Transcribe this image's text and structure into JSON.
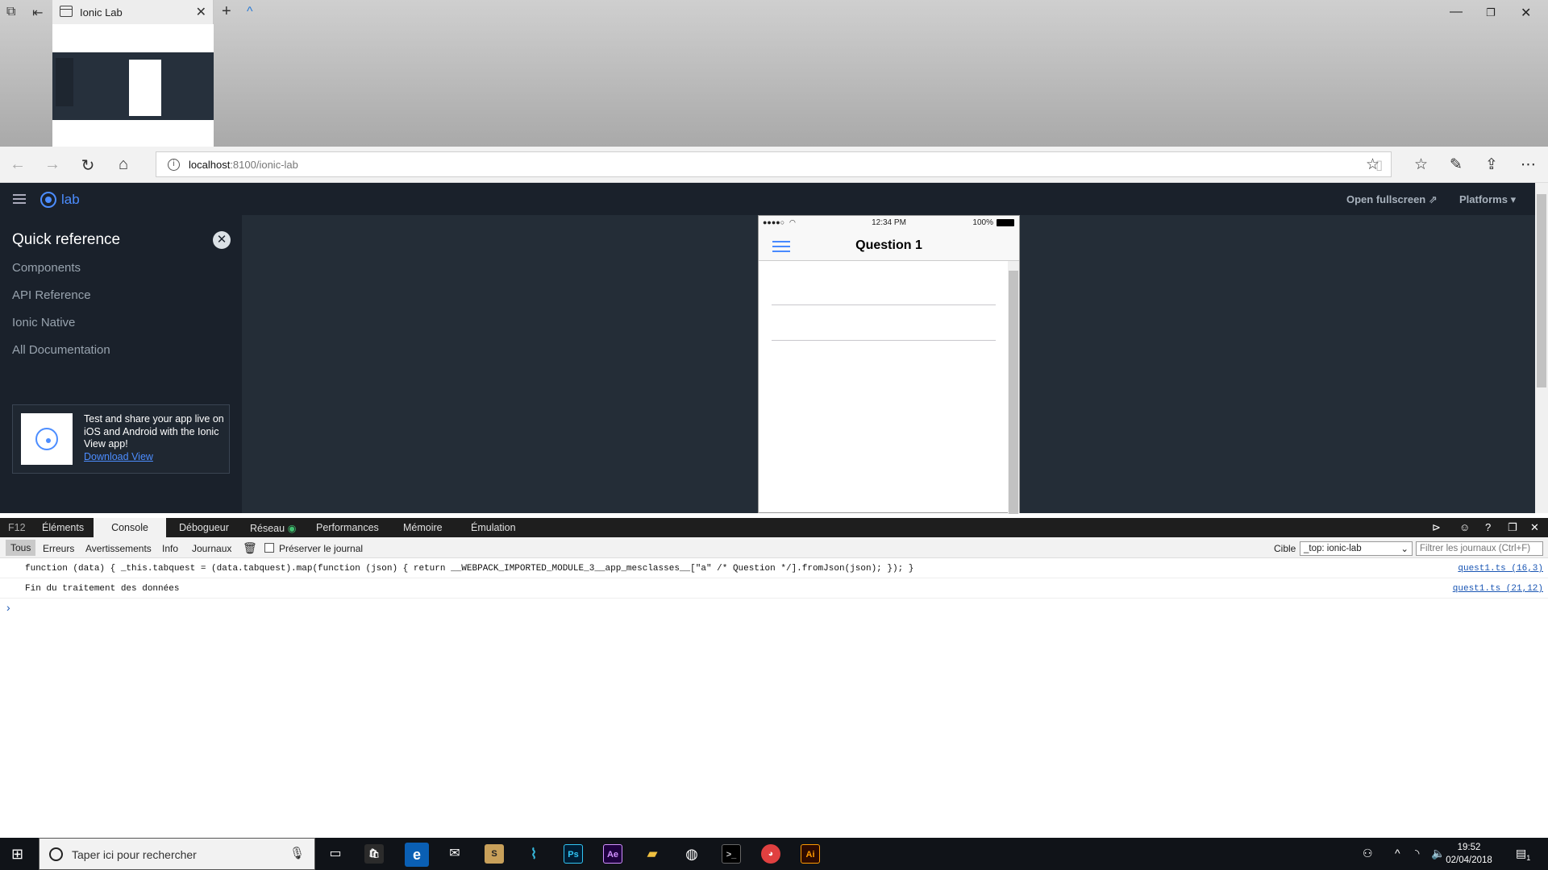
{
  "browser": {
    "tab_title": "Ionic Lab",
    "url_host": "localhost",
    "url_path": ":8100/ionic-lab"
  },
  "lab": {
    "logo_text": "lab",
    "open_fullscreen": "Open fullscreen",
    "platforms": "Platforms",
    "sidebar_title": "Quick reference",
    "sidebar_items": [
      "Components",
      "API Reference",
      "Ionic Native",
      "All Documentation"
    ],
    "promo_text": "Test and share your app live on iOS and Android with the Ionic View app!",
    "promo_link": "Download View"
  },
  "phone": {
    "signal": "●●●●○",
    "time": "12:34 PM",
    "battery": "100%",
    "title": "Question 1"
  },
  "devtools": {
    "f12": "F12",
    "tabs": [
      "Éléments",
      "Console",
      "Débogueur",
      "Réseau",
      "Performances",
      "Mémoire",
      "Émulation"
    ],
    "filters": [
      "Tous",
      "Erreurs",
      "Avertissements",
      "Info",
      "Journaux"
    ],
    "preserve_log": "Préserver le journal",
    "target_label": "Cible",
    "target_value": "_top: ionic-lab",
    "filter_placeholder": "Filtrer les journaux (Ctrl+F)",
    "logs": [
      {
        "msg": "function (data) { _this.tabquest = (data.tabquest).map(function (json) { return __WEBPACK_IMPORTED_MODULE_3__app_mesclasses__[\"a\" /* Question */].fromJson(json); }); }",
        "src": "quest1.ts (16,3)"
      },
      {
        "msg": "Fin du traitement des données",
        "src": "quest1.ts (21,12)"
      }
    ],
    "prompt": "›"
  },
  "taskbar": {
    "search_placeholder": "Taper ici pour rechercher",
    "time": "19:52",
    "date": "02/04/2018",
    "apps": [
      "Ps",
      "Ae",
      "Ai"
    ],
    "notifications_badge": "1"
  },
  "colors": {
    "ionic_blue": "#4c8dff",
    "lab_bg": "#242d37",
    "devtools_bar": "#1e1e1e"
  }
}
